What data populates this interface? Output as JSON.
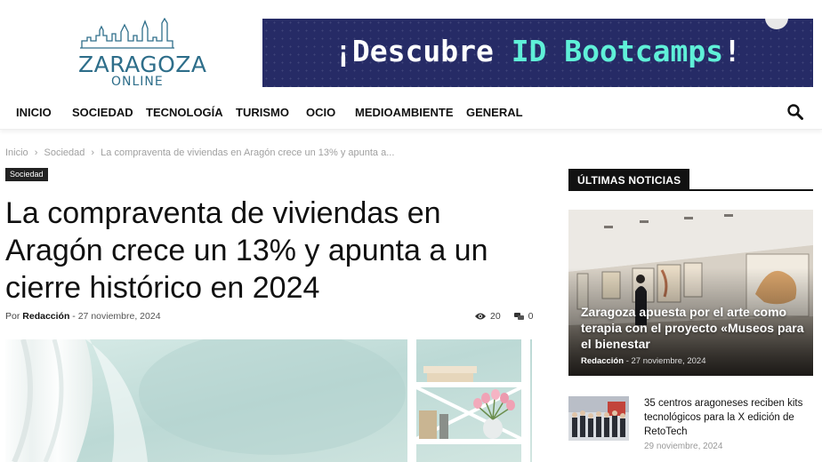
{
  "logo": {
    "name": "ZARAGOZA",
    "sub": "ONLINE"
  },
  "banner": {
    "prefix": "¡Descubre ",
    "highlight": "ID Bootcamps",
    "suffix": "!"
  },
  "nav": {
    "items": [
      "INICIO",
      "SOCIEDAD",
      "TECNOLOGÍA",
      "TURISMO",
      "OCIO",
      "MEDIOAMBIENTE",
      "GENERAL"
    ]
  },
  "breadcrumb": {
    "items": [
      "Inicio",
      "Sociedad",
      "La compraventa de viviendas en Aragón crece un 13% y apunta a..."
    ],
    "separator": "›"
  },
  "article": {
    "category": "Sociedad",
    "title": "La compraventa de viviendas en Aragón crece un 13% y apunta a un cierre histórico en 2024",
    "by": "Por",
    "author": "Redacción",
    "dash": "-",
    "date": "27 noviembre, 2024",
    "views": "20",
    "comments": "0"
  },
  "sidebar": {
    "heading": "ÚLTIMAS NOTICIAS",
    "featured": {
      "title": "Zaragoza apuesta por el arte como terapia con el proyecto «Museos para el bienestar",
      "author": "Redacción",
      "dash": "-",
      "date": "27 noviembre, 2024"
    },
    "item": {
      "title": "35 centros aragoneses reciben kits tecnológicos para la X edición de RetoTech",
      "date": "29 noviembre, 2024"
    }
  }
}
